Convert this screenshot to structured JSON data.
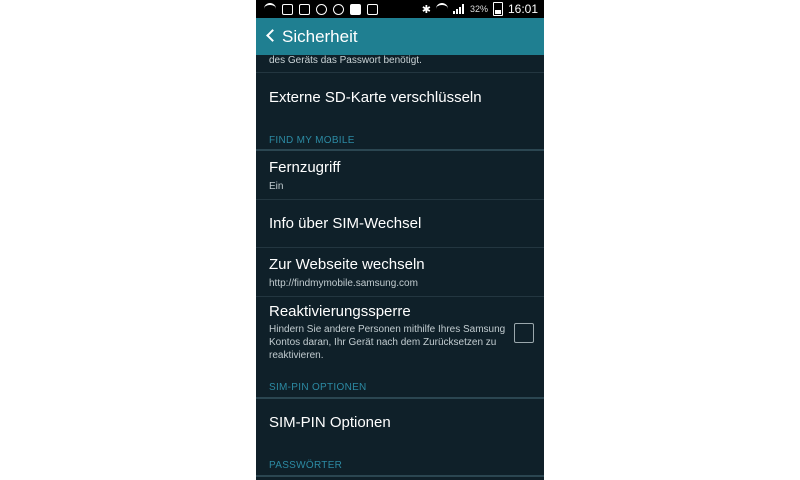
{
  "status_bar": {
    "battery": "32%",
    "time": "16:01"
  },
  "action_bar": {
    "title": "Sicherheit"
  },
  "content": {
    "cut_text": "des Geräts das Passwort benötigt.",
    "items": [
      {
        "title": "Externe SD-Karte verschlüsseln"
      },
      {
        "section": "FIND MY MOBILE"
      },
      {
        "title": "Fernzugriff",
        "subtitle": "Ein"
      },
      {
        "title": "Info über SIM-Wechsel"
      },
      {
        "title": "Zur Webseite wechseln",
        "subtitle": "http://findmymobile.samsung.com"
      },
      {
        "title": "Reaktivierungssperre",
        "description": "Hindern Sie andere Personen mithilfe Ihres Samsung Kontos daran, Ihr Gerät nach dem Zurücksetzen zu reaktivieren.",
        "checked": false
      },
      {
        "section": "SIM-PIN OPTIONEN"
      },
      {
        "title": "SIM-PIN Optionen"
      },
      {
        "section": "PASSWÖRTER"
      }
    ]
  },
  "colors": {
    "action_bar": "#1f7f91",
    "background": "#0f2029",
    "section_header": "#2c8aa3"
  }
}
